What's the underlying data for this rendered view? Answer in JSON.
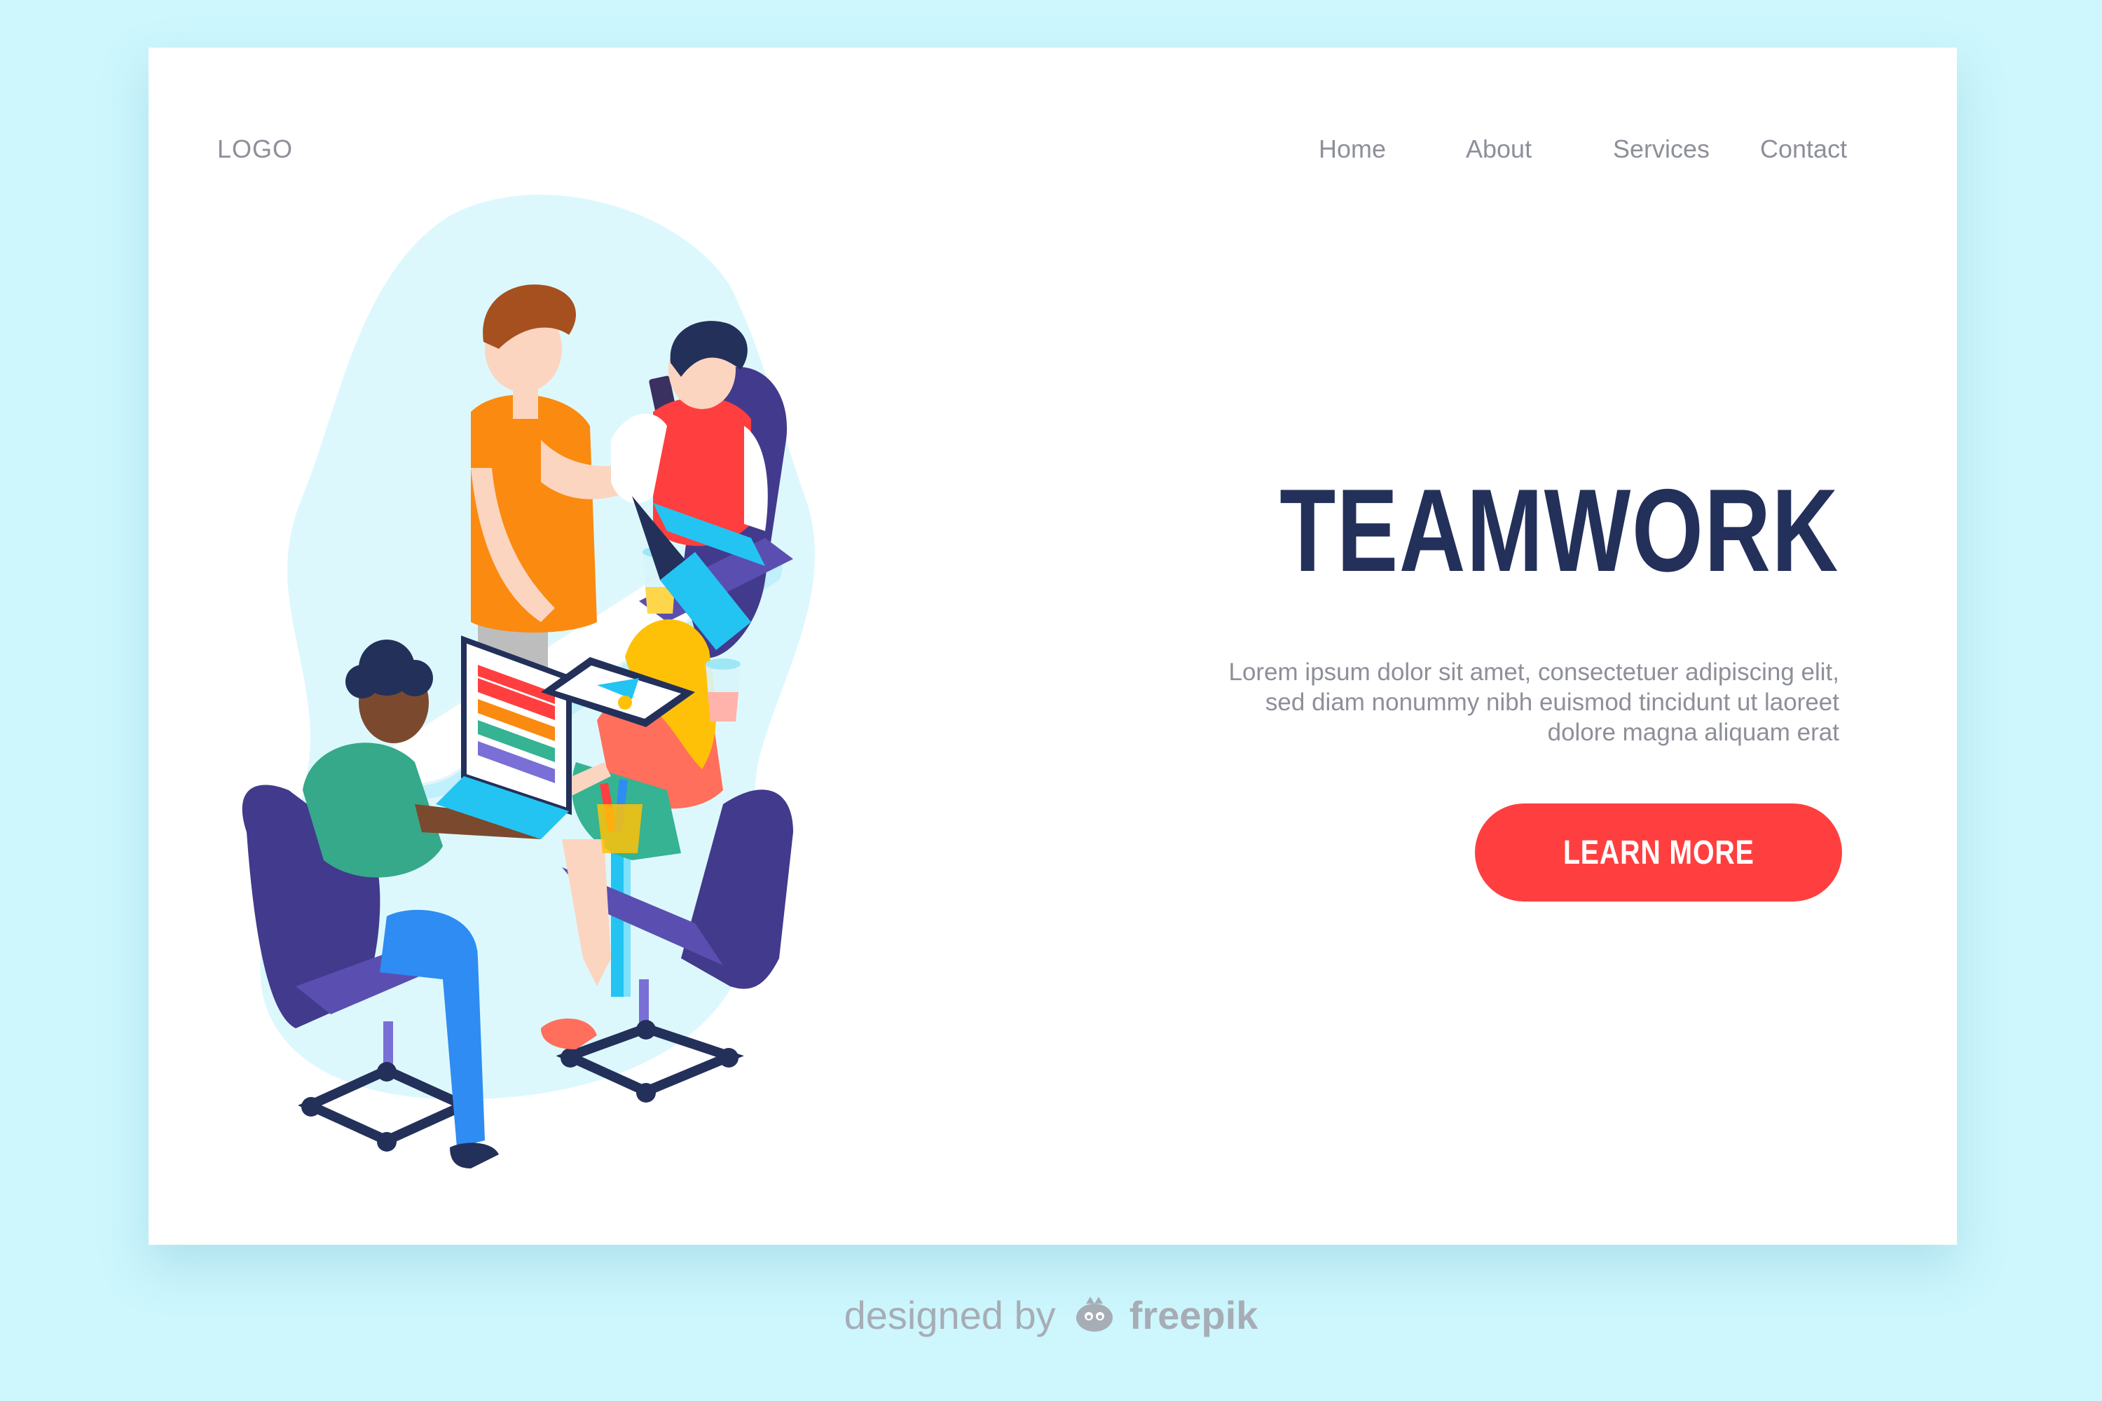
{
  "header": {
    "logo": "LOGO",
    "nav": [
      "Home",
      "About",
      "Services",
      "Contact"
    ]
  },
  "hero": {
    "title": "TEAMWORK",
    "body": "Lorem ipsum dolor sit amet, consectetuer adipiscing elit, sed diam nonummy nibh euismod tincidunt ut laoreet dolore magna aliquam erat",
    "cta": "LEARN MORE"
  },
  "footer": {
    "credit_prefix": "designed by",
    "credit_brand": "freepik"
  },
  "colors": {
    "page_background": "#cdf6fd",
    "title": "#23305a",
    "cta": "#ff3f3f",
    "muted_text": "#8d8f99"
  },
  "icons": {
    "illustration": "isometric-team-meeting-illustration",
    "mascot": "freepik-mascot-icon"
  }
}
